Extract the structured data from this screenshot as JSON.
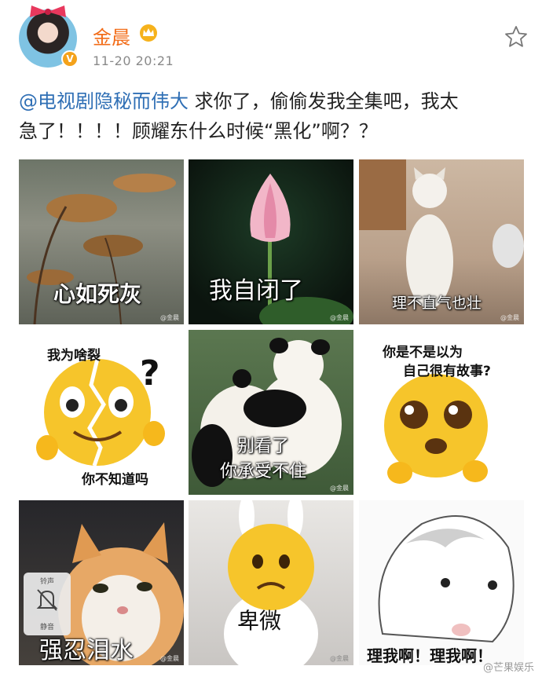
{
  "post": {
    "username": "金晨",
    "timestamp": "11-20 20:21",
    "verified_badge": "V",
    "mention": "@电视剧隐秘而伟大",
    "body_line1": " 求你了，偷偷发我全集吧，我太",
    "body_line2": "急了！！！！顾耀东什么时候“黑化”啊？？"
  },
  "images": [
    {
      "caption": "心如死灰",
      "watermark": "@金晨"
    },
    {
      "caption": "我自闭了",
      "watermark": "@金晨"
    },
    {
      "caption": "理不直气也壮",
      "watermark": "@金晨"
    },
    {
      "caption_top": "我为啥裂",
      "caption_bottom": "你不知道吗",
      "watermark": "@金晨"
    },
    {
      "caption_line1": "别看了",
      "caption_line2": "你承受不住",
      "watermark": "@金晨"
    },
    {
      "caption_line1": "你是不是以为",
      "caption_line2": "自己很有故事?",
      "watermark": "@金晨"
    },
    {
      "caption": "强忍泪水",
      "phone_top": "铃声",
      "phone_bottom": "静音",
      "watermark": "@金晨"
    },
    {
      "caption": "卑微",
      "watermark": "@金晨"
    },
    {
      "caption": "理我啊！理我啊！",
      "watermark": ""
    }
  ],
  "site_watermark": "@芒果娱乐",
  "colors": {
    "username": "#f26c18",
    "mention": "#2f6fb5",
    "timestamp": "#8a8a8a"
  },
  "icons": [
    "crown-icon",
    "star-icon",
    "verified-icon",
    "bow-icon",
    "question-icon",
    "bell-muted-icon"
  ]
}
